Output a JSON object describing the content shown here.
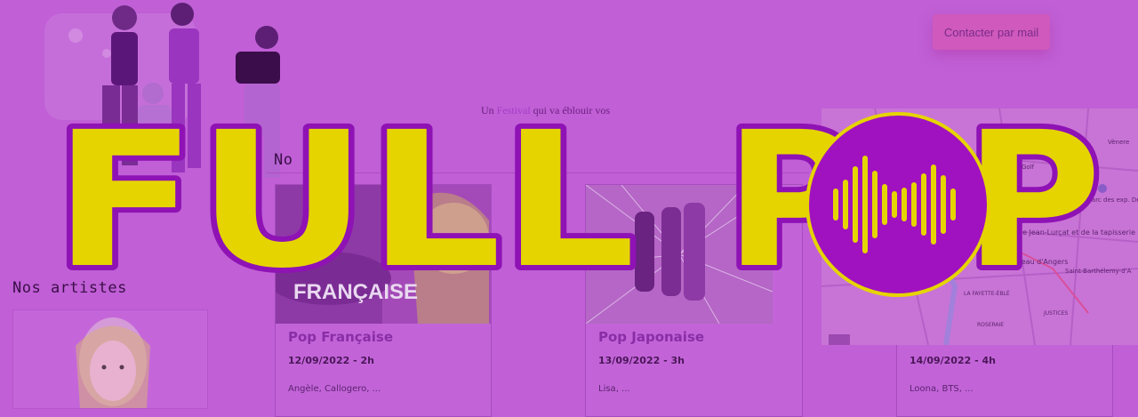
{
  "header": {
    "contact_button": "Contacter par mail"
  },
  "tagline": {
    "before": "Un ",
    "accent": "Festival",
    "after": " qui va éblouir vos"
  },
  "logo": {
    "text_left": "FULL",
    "text_p1": "P",
    "text_p2": "P"
  },
  "concerts_section": {
    "title_partial": "No"
  },
  "artists_section": {
    "title": "Nos artistes"
  },
  "concerts": [
    {
      "title": "Pop Française",
      "date": "12/09/2022 - 2h",
      "artists": "Angèle, Callogero, ...",
      "image_text": "FRANÇAISE"
    },
    {
      "title": "Pop Japonaise",
      "date": "13/09/2022 - 3h",
      "artists": "Lisa, ..."
    },
    {
      "title": "",
      "date": "14/09/2022 - 4h",
      "artists": "Loona, BTS, ..."
    }
  ],
  "map": {
    "labels": [
      "Musée Jean-Lurçat et de la tapisserie",
      "Château d'Angers",
      "Saint-Barthélemy-d'A",
      "LA FAYETTE-ÉBLÉ",
      "JUSTICES",
      "ROSERAIE",
      "Parc des exp. Destination",
      "Golf",
      "Vènere"
    ]
  },
  "colors": {
    "background": "#c05fd6",
    "logo_fill": "#e6d400",
    "logo_stroke": "#8f12b5",
    "logo_circle": "#a012c0"
  }
}
